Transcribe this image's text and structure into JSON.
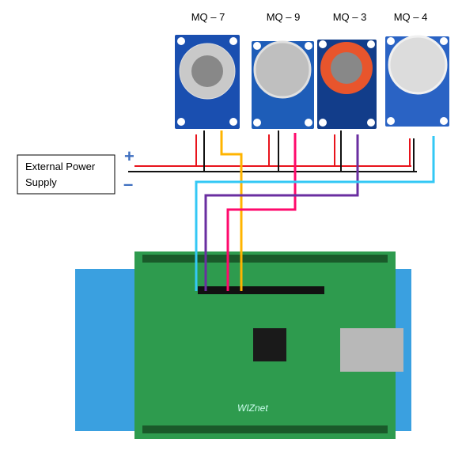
{
  "sensors": [
    {
      "label": "MQ – 7"
    },
    {
      "label": "MQ – 9"
    },
    {
      "label": "MQ – 3"
    },
    {
      "label": "MQ – 4"
    }
  ],
  "power": {
    "line1": "External Power",
    "line2": "Supply",
    "plus": "+",
    "minus": "–"
  },
  "board": {
    "logo": "WIZnet"
  },
  "colors": {
    "vcc": "#e8141c",
    "gnd": "#111111",
    "mq7_signal": "#ffb400",
    "mq9_signal": "#ff0a6c",
    "mq3_signal": "#6a2ea0",
    "mq4_signal": "#33c8f5",
    "pcb_blue": "#1a4fb0",
    "shield_green": "#2e9b4e",
    "nucleo_blue": "#3aa0e0"
  }
}
